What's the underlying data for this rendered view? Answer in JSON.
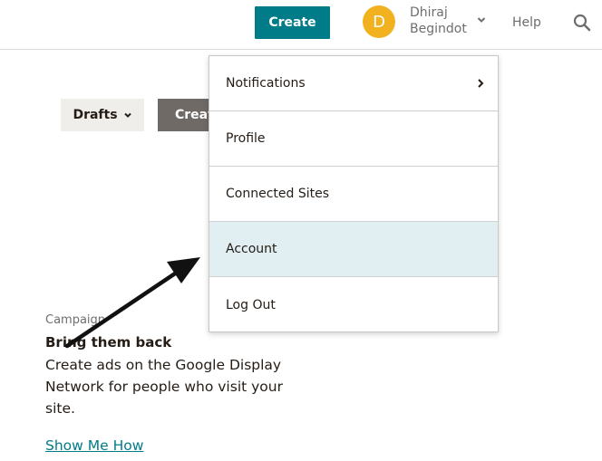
{
  "header": {
    "create_label": "Create",
    "avatar_initial": "D",
    "user_first": "Dhiraj",
    "user_last": "Begindot",
    "help_label": "Help"
  },
  "toolbar": {
    "drafts_label": "Drafts",
    "create_label": "Create"
  },
  "campaign": {
    "eyebrow": "Campaign",
    "title": "Bring them back",
    "description": "Create ads on the Google Display Network for people who visit your site.",
    "link": "Show Me How"
  },
  "menu": {
    "items": [
      {
        "label": "Notifications",
        "has_submenu": true
      },
      {
        "label": "Profile"
      },
      {
        "label": "Connected Sites"
      },
      {
        "label": "Account",
        "highlighted": true
      },
      {
        "label": "Log Out"
      }
    ]
  },
  "colors": {
    "brand": "#007c89",
    "avatar": "#f2b21f",
    "highlight": "#e1eff2"
  }
}
